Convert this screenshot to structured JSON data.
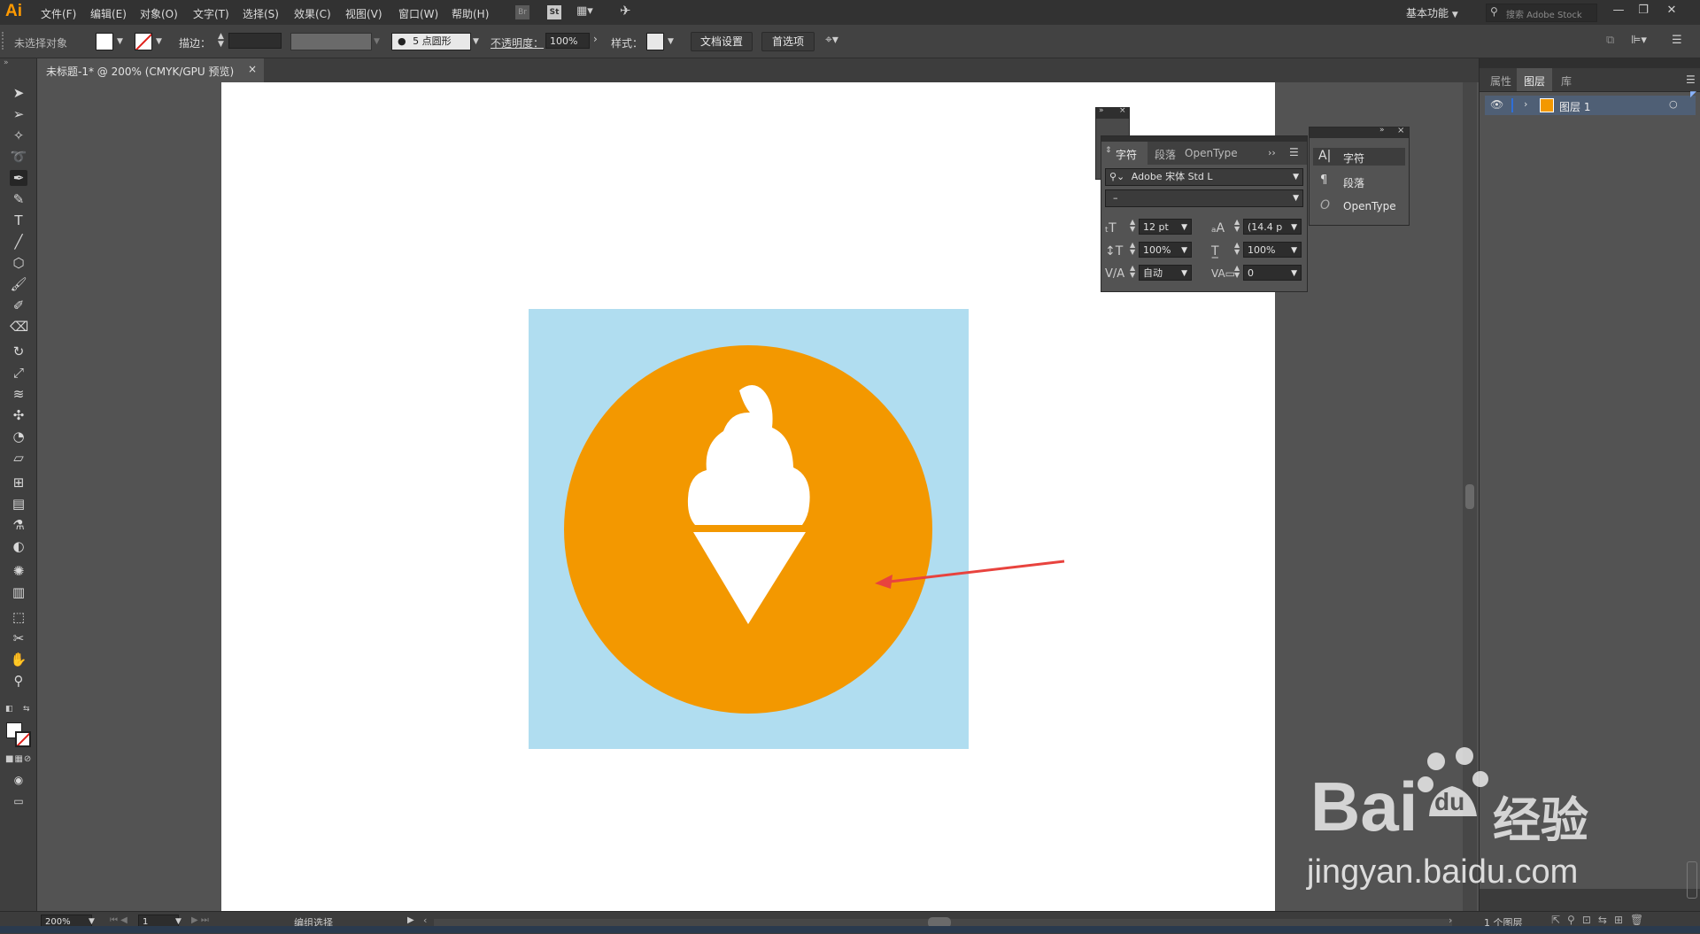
{
  "app": {
    "logo": "Ai"
  },
  "menu": [
    "文件(F)",
    "编辑(E)",
    "对象(O)",
    "文字(T)",
    "选择(S)",
    "效果(C)",
    "视图(V)",
    "窗口(W)",
    "帮助(H)"
  ],
  "menu_icons": {
    "br": "Br",
    "st": "St"
  },
  "workspace": "基本功能",
  "search": {
    "placeholder": "搜索 Adobe Stock"
  },
  "control": {
    "no_selection": "未选择对象",
    "stroke_label": "描边：",
    "brush": "5 点圆形",
    "opacity_label": "不透明度：",
    "opacity_value": "100%",
    "style_label": "样式：",
    "doc_setup": "文档设置",
    "prefs": "首选项"
  },
  "doc_tab": {
    "title": "未标题-1* @ 200% (CMYK/GPU 预览)",
    "close": "×"
  },
  "right_panel": {
    "tabs": [
      "属性",
      "图层",
      "库"
    ],
    "layer_name": "图层 1",
    "layer_count": "1 个图层"
  },
  "char_panel": {
    "tabs": [
      "字符",
      "段落",
      "OpenType"
    ],
    "font": "Adobe 宋体 Std L",
    "style": "–",
    "size": "12 pt",
    "leading": "(14.4 p",
    "v_scale": "100%",
    "h_scale": "100%",
    "kerning": "自动",
    "tracking": "0"
  },
  "flyout": [
    "字符",
    "段落",
    "OpenType"
  ],
  "status": {
    "zoom": "200%",
    "page": "1",
    "mode": "编组选择"
  },
  "watermark": {
    "line1": "Bai",
    "du": "du",
    "cn": "经验",
    "line2": "jingyan.baidu.com"
  },
  "colors": {
    "bg_square": "#b0ddf0",
    "circle": "#f39800",
    "icon": "#ffffff",
    "arrow": "#e8433e"
  }
}
